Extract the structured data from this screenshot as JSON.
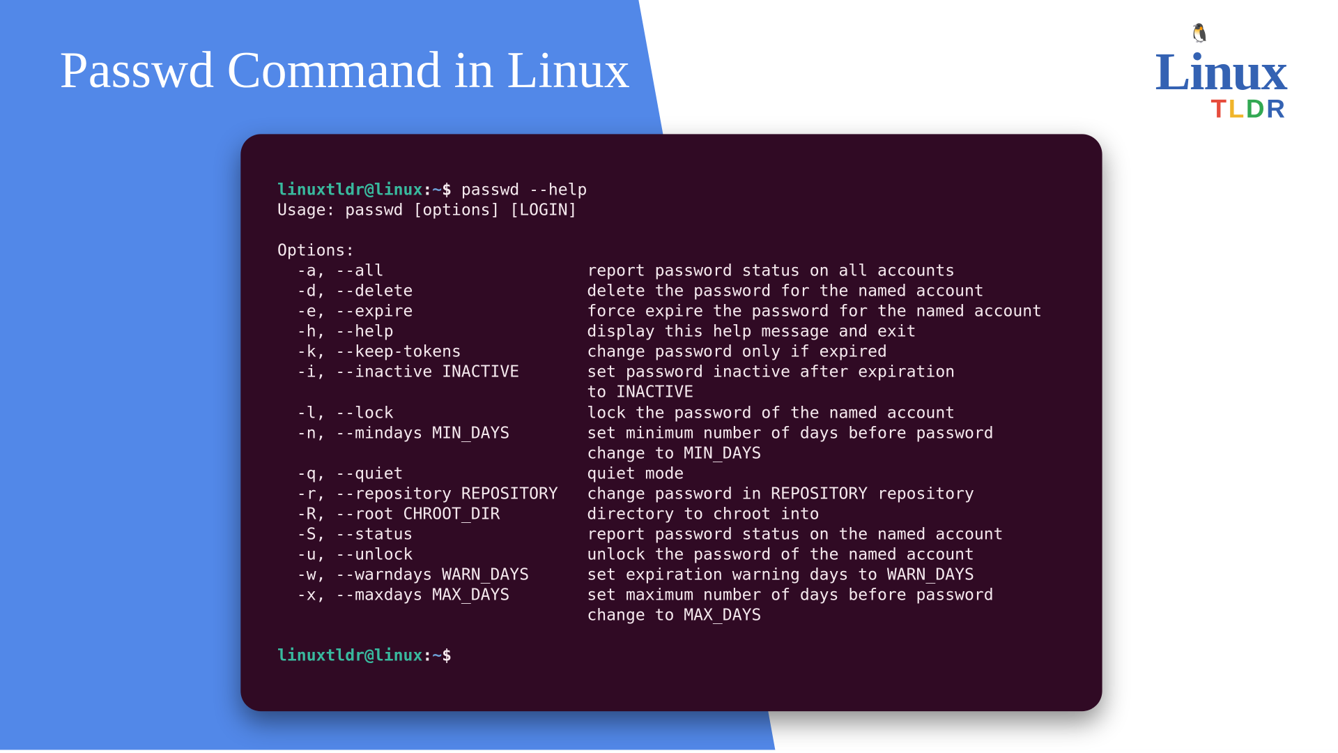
{
  "title": "Passwd Command in Linux",
  "logo": {
    "main": "Linux",
    "sub_t": "T",
    "sub_l": "L",
    "sub_d": "D",
    "sub_r": "R"
  },
  "terminal": {
    "prompt_host": "linuxtldr@linux",
    "prompt_colon": ":",
    "prompt_tilde": "~",
    "prompt_dollar": "$ ",
    "command": "passwd --help",
    "usage": "Usage: passwd [options] [LOGIN]",
    "options_header": "Options:",
    "options": [
      {
        "flag": "  -a, --all",
        "desc": "report password status on all accounts"
      },
      {
        "flag": "  -d, --delete",
        "desc": "delete the password for the named account"
      },
      {
        "flag": "  -e, --expire",
        "desc": "force expire the password for the named account"
      },
      {
        "flag": "  -h, --help",
        "desc": "display this help message and exit"
      },
      {
        "flag": "  -k, --keep-tokens",
        "desc": "change password only if expired"
      },
      {
        "flag": "  -i, --inactive INACTIVE",
        "desc": "set password inactive after expiration",
        "cont": "to INACTIVE"
      },
      {
        "flag": "  -l, --lock",
        "desc": "lock the password of the named account"
      },
      {
        "flag": "  -n, --mindays MIN_DAYS",
        "desc": "set minimum number of days before password",
        "cont": "change to MIN_DAYS"
      },
      {
        "flag": "  -q, --quiet",
        "desc": "quiet mode"
      },
      {
        "flag": "  -r, --repository REPOSITORY",
        "desc": "change password in REPOSITORY repository"
      },
      {
        "flag": "  -R, --root CHROOT_DIR",
        "desc": "directory to chroot into"
      },
      {
        "flag": "  -S, --status",
        "desc": "report password status on the named account"
      },
      {
        "flag": "  -u, --unlock",
        "desc": "unlock the password of the named account"
      },
      {
        "flag": "  -w, --warndays WARN_DAYS",
        "desc": "set expiration warning days to WARN_DAYS"
      },
      {
        "flag": "  -x, --maxdays MAX_DAYS",
        "desc": "set maximum number of days before password",
        "cont": "change to MAX_DAYS"
      }
    ]
  },
  "flag_col_width": 32
}
